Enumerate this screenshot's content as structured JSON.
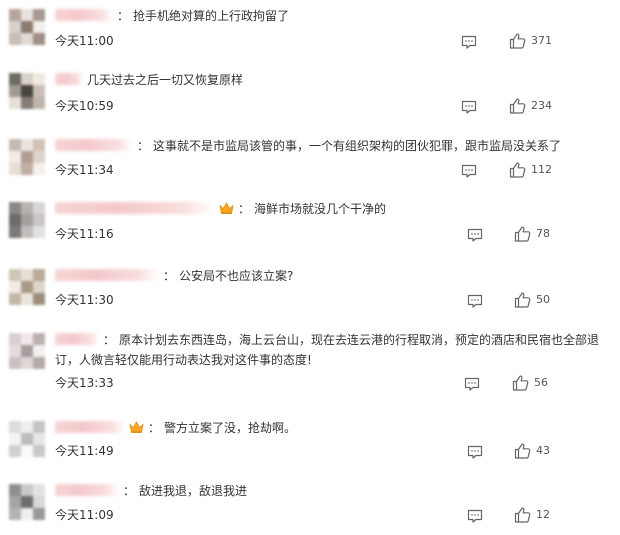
{
  "comments": [
    {
      "text": "抢手机绝对算的上行政拘留了",
      "time": "今天11:00",
      "likes": "371",
      "has_crown": false,
      "has_colon": true
    },
    {
      "text": "几天过去之后一切又恢复原样",
      "time": "今天10:59",
      "likes": "234",
      "has_crown": false,
      "has_colon": false
    },
    {
      "text": "这事就不是市监局该管的事，一个有组织架构的团伙犯罪，跟市监局没关系了",
      "time": "今天11:34",
      "likes": "112",
      "has_crown": false,
      "has_colon": true
    },
    {
      "text": "海鲜市场就没几个干净的",
      "time": "今天11:16",
      "likes": "78",
      "has_crown": true,
      "has_colon": true
    },
    {
      "text": "公安局不也应该立案?",
      "time": "今天11:30",
      "likes": "50",
      "has_crown": false,
      "has_colon": true
    },
    {
      "text": "原本计划去东西连岛，海上云台山，现在去连云港的行程取消，预定的酒店和民宿也全部退订，人微言轻仅能用行动表达我对这件事的态度!",
      "time": "今天13:33",
      "likes": "56",
      "has_crown": false,
      "has_colon": true
    },
    {
      "text": "警方立案了没，抢劫啊。",
      "time": "今天11:49",
      "likes": "43",
      "has_crown": true,
      "has_colon": true
    },
    {
      "text": "敌进我退，敌退我进",
      "time": "今天11:09",
      "likes": "12",
      "has_crown": false,
      "has_colon": true
    }
  ],
  "colors": {
    "text": "#333333",
    "icon": "#666666",
    "crown": "#f5a623",
    "background": "#ffffff"
  },
  "icons": {
    "reply": "comment-bubble-icon",
    "like": "thumbs-up-icon",
    "badge": "crown-icon"
  }
}
